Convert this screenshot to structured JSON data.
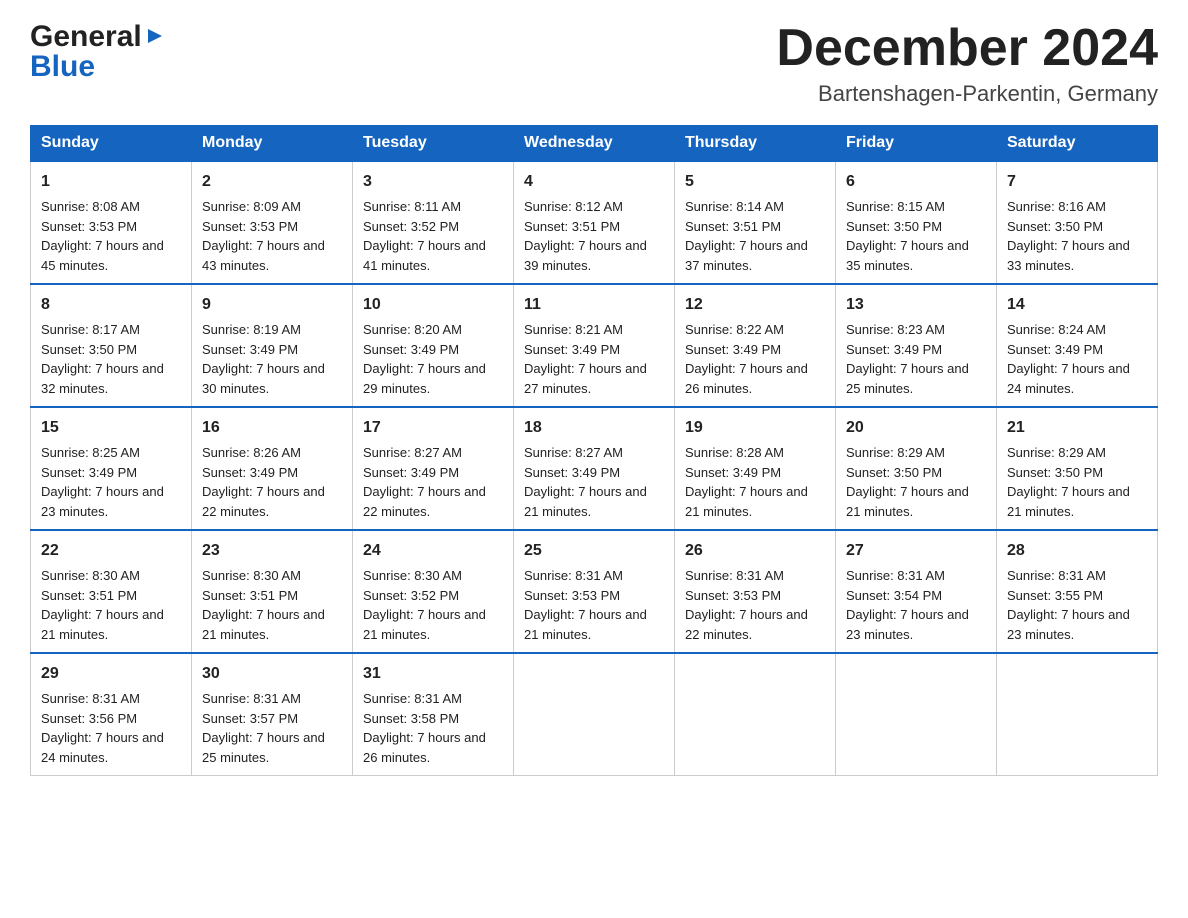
{
  "header": {
    "logo": {
      "general": "General",
      "blue": "Blue",
      "arrow": "▶"
    },
    "title": "December 2024",
    "subtitle": "Bartenshagen-Parkentin, Germany"
  },
  "days": [
    "Sunday",
    "Monday",
    "Tuesday",
    "Wednesday",
    "Thursday",
    "Friday",
    "Saturday"
  ],
  "weeks": [
    [
      {
        "day": 1,
        "sunrise": "8:08 AM",
        "sunset": "3:53 PM",
        "daylight": "7 hours and 45 minutes."
      },
      {
        "day": 2,
        "sunrise": "8:09 AM",
        "sunset": "3:53 PM",
        "daylight": "7 hours and 43 minutes."
      },
      {
        "day": 3,
        "sunrise": "8:11 AM",
        "sunset": "3:52 PM",
        "daylight": "7 hours and 41 minutes."
      },
      {
        "day": 4,
        "sunrise": "8:12 AM",
        "sunset": "3:51 PM",
        "daylight": "7 hours and 39 minutes."
      },
      {
        "day": 5,
        "sunrise": "8:14 AM",
        "sunset": "3:51 PM",
        "daylight": "7 hours and 37 minutes."
      },
      {
        "day": 6,
        "sunrise": "8:15 AM",
        "sunset": "3:50 PM",
        "daylight": "7 hours and 35 minutes."
      },
      {
        "day": 7,
        "sunrise": "8:16 AM",
        "sunset": "3:50 PM",
        "daylight": "7 hours and 33 minutes."
      }
    ],
    [
      {
        "day": 8,
        "sunrise": "8:17 AM",
        "sunset": "3:50 PM",
        "daylight": "7 hours and 32 minutes."
      },
      {
        "day": 9,
        "sunrise": "8:19 AM",
        "sunset": "3:49 PM",
        "daylight": "7 hours and 30 minutes."
      },
      {
        "day": 10,
        "sunrise": "8:20 AM",
        "sunset": "3:49 PM",
        "daylight": "7 hours and 29 minutes."
      },
      {
        "day": 11,
        "sunrise": "8:21 AM",
        "sunset": "3:49 PM",
        "daylight": "7 hours and 27 minutes."
      },
      {
        "day": 12,
        "sunrise": "8:22 AM",
        "sunset": "3:49 PM",
        "daylight": "7 hours and 26 minutes."
      },
      {
        "day": 13,
        "sunrise": "8:23 AM",
        "sunset": "3:49 PM",
        "daylight": "7 hours and 25 minutes."
      },
      {
        "day": 14,
        "sunrise": "8:24 AM",
        "sunset": "3:49 PM",
        "daylight": "7 hours and 24 minutes."
      }
    ],
    [
      {
        "day": 15,
        "sunrise": "8:25 AM",
        "sunset": "3:49 PM",
        "daylight": "7 hours and 23 minutes."
      },
      {
        "day": 16,
        "sunrise": "8:26 AM",
        "sunset": "3:49 PM",
        "daylight": "7 hours and 22 minutes."
      },
      {
        "day": 17,
        "sunrise": "8:27 AM",
        "sunset": "3:49 PM",
        "daylight": "7 hours and 22 minutes."
      },
      {
        "day": 18,
        "sunrise": "8:27 AM",
        "sunset": "3:49 PM",
        "daylight": "7 hours and 21 minutes."
      },
      {
        "day": 19,
        "sunrise": "8:28 AM",
        "sunset": "3:49 PM",
        "daylight": "7 hours and 21 minutes."
      },
      {
        "day": 20,
        "sunrise": "8:29 AM",
        "sunset": "3:50 PM",
        "daylight": "7 hours and 21 minutes."
      },
      {
        "day": 21,
        "sunrise": "8:29 AM",
        "sunset": "3:50 PM",
        "daylight": "7 hours and 21 minutes."
      }
    ],
    [
      {
        "day": 22,
        "sunrise": "8:30 AM",
        "sunset": "3:51 PM",
        "daylight": "7 hours and 21 minutes."
      },
      {
        "day": 23,
        "sunrise": "8:30 AM",
        "sunset": "3:51 PM",
        "daylight": "7 hours and 21 minutes."
      },
      {
        "day": 24,
        "sunrise": "8:30 AM",
        "sunset": "3:52 PM",
        "daylight": "7 hours and 21 minutes."
      },
      {
        "day": 25,
        "sunrise": "8:31 AM",
        "sunset": "3:53 PM",
        "daylight": "7 hours and 21 minutes."
      },
      {
        "day": 26,
        "sunrise": "8:31 AM",
        "sunset": "3:53 PM",
        "daylight": "7 hours and 22 minutes."
      },
      {
        "day": 27,
        "sunrise": "8:31 AM",
        "sunset": "3:54 PM",
        "daylight": "7 hours and 23 minutes."
      },
      {
        "day": 28,
        "sunrise": "8:31 AM",
        "sunset": "3:55 PM",
        "daylight": "7 hours and 23 minutes."
      }
    ],
    [
      {
        "day": 29,
        "sunrise": "8:31 AM",
        "sunset": "3:56 PM",
        "daylight": "7 hours and 24 minutes."
      },
      {
        "day": 30,
        "sunrise": "8:31 AM",
        "sunset": "3:57 PM",
        "daylight": "7 hours and 25 minutes."
      },
      {
        "day": 31,
        "sunrise": "8:31 AM",
        "sunset": "3:58 PM",
        "daylight": "7 hours and 26 minutes."
      },
      null,
      null,
      null,
      null
    ]
  ]
}
